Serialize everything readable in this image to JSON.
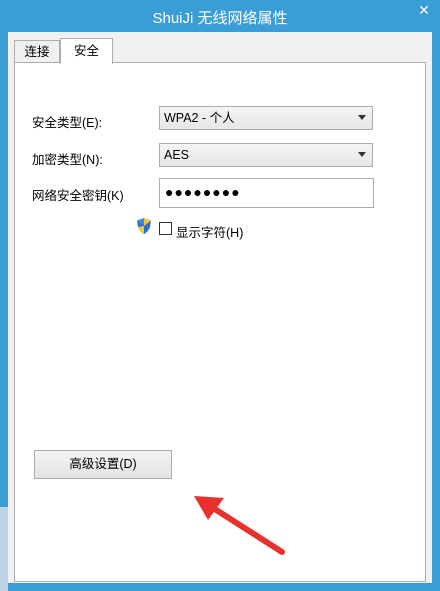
{
  "window": {
    "title": "ShuiJi 无线网络属性",
    "close_glyph": "✕"
  },
  "tabs": [
    {
      "label": "连接"
    },
    {
      "label": "安全"
    }
  ],
  "security": {
    "security_type_label": "安全类型(E):",
    "security_type_value": "WPA2 - 个人",
    "encryption_type_label": "加密类型(N):",
    "encryption_type_value": "AES",
    "key_label": "网络安全密钥(K)",
    "key_value": "●●●●●●●●",
    "show_chars_label": "显示字符(H)",
    "show_chars_checked": false
  },
  "buttons": {
    "advanced_label": "高级设置(D)"
  },
  "colors": {
    "title_bar": "#3b9dd6",
    "annotation_arrow": "#e8302e"
  }
}
